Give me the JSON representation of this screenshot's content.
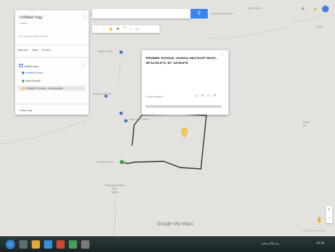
{
  "map": {
    "labels": [
      {
        "key": "top_center",
        "text": "Guwahati\nBalanch"
      },
      {
        "key": "top_right",
        "text": "Amin Karia"
      },
      {
        "key": "top_right2",
        "text": "Xabe"
      },
      {
        "key": "poi1",
        "text": "Satra Toran"
      },
      {
        "key": "poi2",
        "text": "Baruah\nSchool"
      },
      {
        "key": "poi3",
        "text": "Maa Tarini\nStore"
      },
      {
        "key": "poi4",
        "text": "Khetri Baruah"
      },
      {
        "key": "bottom_place",
        "text": "Uttarpara Bhatia\nजला\nMatia"
      },
      {
        "key": "right_place",
        "text": "Tahini\nगांव"
      }
    ]
  },
  "panel": {
    "title": "Untitled map",
    "subtitle": "0 views",
    "status": "All changes saved in Drive",
    "toolbar": [
      "Add layer",
      "Share",
      "Preview"
    ],
    "layer_name": "Untitled layer",
    "items": [
      {
        "label": "Individual styles",
        "color": "#3a6fbf"
      },
      {
        "label": "Khetri Baruah",
        "color": "#3aa34a"
      },
      {
        "label": "PROBEE SCHOOL, JAKHALABA...",
        "color": "#f2c94c"
      }
    ],
    "base_map": "Base map"
  },
  "search": {
    "placeholder": "",
    "button_icon": "search-icon"
  },
  "map_toolbar": [
    "←",
    "→",
    "✋",
    "⚑",
    "⌒",
    "⟋",
    "▭"
  ],
  "infowindow": {
    "title": "PROBEE SCHOOL JAKHALABA EAST MAYA, 25°14'33.8\"N, 91° 43'26.8\"E",
    "style_link": "▾ Style (default)",
    "actions": [
      "▭",
      "✎",
      "☉",
      "⁇"
    ],
    "close": "×"
  },
  "google_logo": "Google My Maps",
  "attribution": "Map data ©2018 Google",
  "zoom": {
    "plus": "+",
    "minus": "−"
  },
  "top_right_icons": [
    "≡",
    "●"
  ],
  "taskbar": {
    "tray_text": "Links ▴ हिं ▴ ▲ ♪",
    "clock": "12:44"
  },
  "colors": {
    "accent": "#3b83ee",
    "route": "#2b2b2b",
    "marker_selected": "#f2c94c",
    "marker_green": "#3aa34a",
    "marker_blue": "#3a6fbf"
  }
}
